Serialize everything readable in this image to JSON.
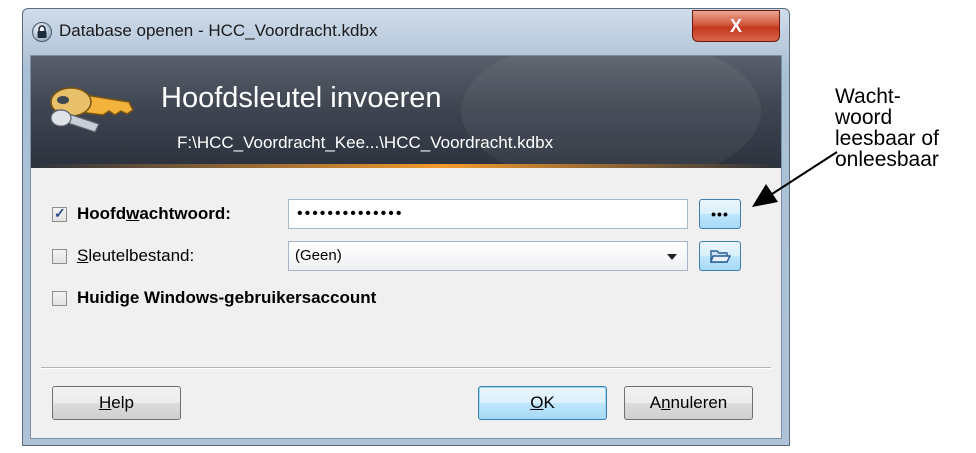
{
  "window": {
    "title": "Database openen - HCC_Voordracht.kdbx",
    "close_label": "X"
  },
  "banner": {
    "title": "Hoofdsleutel invoeren",
    "path": "F:\\HCC_Voordracht_Kee...\\HCC_Voordracht.kdbx"
  },
  "form": {
    "master_password": {
      "checked": true,
      "label_pre": "Hoofd",
      "label_mnemonic": "w",
      "label_post": "achtwoord:",
      "value": "••••••••••••••",
      "reveal_button": "•••"
    },
    "key_file": {
      "checked": false,
      "label_mnemonic": "S",
      "label_post": "leutelbestand:",
      "selected": "(Geen)"
    },
    "windows_account": {
      "checked": false,
      "label_pre": "Huidige Windows-",
      "label_mnemonic": "g",
      "label_post": "ebruikersaccount"
    }
  },
  "buttons": {
    "help_mnemonic": "H",
    "help_rest": "elp",
    "ok_mnemonic": "O",
    "ok_rest": "K",
    "cancel_pre": "A",
    "cancel_mnemonic": "n",
    "cancel_post": "nuleren"
  },
  "annotation": {
    "lines": [
      "Wacht-",
      "woord",
      "leesbaar of",
      "onleesbaar"
    ]
  },
  "colors": {
    "banner_accent": "#f39a2c",
    "close_button": "#c13a1d",
    "focus_border": "#3c7fb1"
  }
}
